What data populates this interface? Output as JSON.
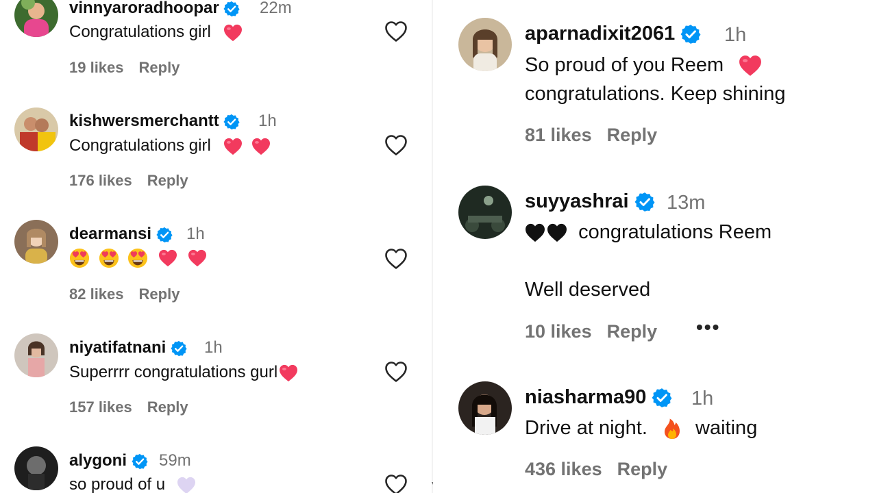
{
  "left_comments": [
    {
      "username": "vinnyaroradhoopar",
      "time": "22m",
      "text": "Congratulations girl",
      "emoji": [
        "heart"
      ],
      "likes": "19 likes",
      "reply": "Reply"
    },
    {
      "username": "kishwersmerchantt",
      "time": "1h",
      "text": "Congratulations girl",
      "emoji": [
        "heart",
        "heart"
      ],
      "likes": "176 likes",
      "reply": "Reply"
    },
    {
      "username": "dearmansi",
      "time": "1h",
      "text": "",
      "emoji": [
        "heart-eyes",
        "heart-eyes",
        "heart-eyes",
        "heart",
        "heart"
      ],
      "likes": "82 likes",
      "reply": "Reply"
    },
    {
      "username": "niyatifatnani",
      "time": "1h",
      "text": "Superrrr congratulations gurl",
      "emoji": [
        "heart"
      ],
      "likes": "157 likes",
      "reply": "Reply"
    },
    {
      "username": "alygoni",
      "time": "59m",
      "text": "so proud of u",
      "emoji": [
        "lavender-heart"
      ],
      "likes": "",
      "reply": ""
    }
  ],
  "right_comments": [
    {
      "username": "aparnadixit2061",
      "time": "1h",
      "line1": "So proud of you Reem",
      "line2": "congratulations. Keep shining",
      "emoji": [
        "heart"
      ],
      "likes": "81 likes",
      "reply": "Reply"
    },
    {
      "username": "suyyashrai",
      "time": "13m",
      "line1": "congratulations Reem",
      "line2": "Well deserved",
      "emoji": [
        "black-heart",
        "black-heart"
      ],
      "likes": "10 likes",
      "reply": "Reply",
      "more": "•••"
    },
    {
      "username": "niasharma90",
      "time": "1h",
      "line1": "Drive at night.",
      "line2": "waiting",
      "emoji": [
        "fire"
      ],
      "likes": "436 likes",
      "reply": "Reply"
    }
  ],
  "colors": {
    "verified": "#0095f6",
    "meta": "#737373",
    "heart": "#ff3040"
  },
  "icons": {
    "like": "heart-outline-icon",
    "verified": "verified-badge-icon",
    "more": "more-options-icon"
  }
}
